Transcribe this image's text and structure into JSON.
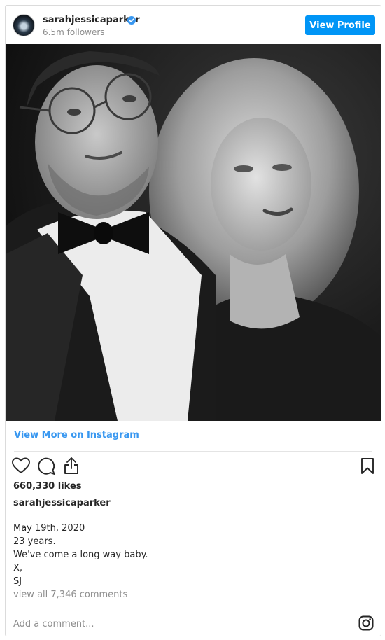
{
  "header": {
    "username": "sarahjessicaparker",
    "followers": "6.5m followers",
    "view_profile_label": "View Profile",
    "verified_icon": "verified-badge-icon"
  },
  "post": {
    "view_more_label": "View More on Instagram",
    "likes": "660,330 likes",
    "caption_username": "sarahjessicaparker",
    "caption_lines": [
      "May 19th, 2020",
      "23 years.",
      "We've come a long way baby.",
      "X,",
      "SJ"
    ],
    "comments_link": "view all 7,346 comments",
    "add_comment_placeholder": "Add a comment..."
  },
  "icons": {
    "like": "heart-icon",
    "comment": "comment-icon",
    "share": "share-icon",
    "save": "bookmark-icon",
    "instagram": "instagram-logo-icon"
  },
  "colors": {
    "accent": "#0095f6",
    "link": "#3897f0",
    "muted": "#8e8e8e",
    "text": "#262626"
  }
}
